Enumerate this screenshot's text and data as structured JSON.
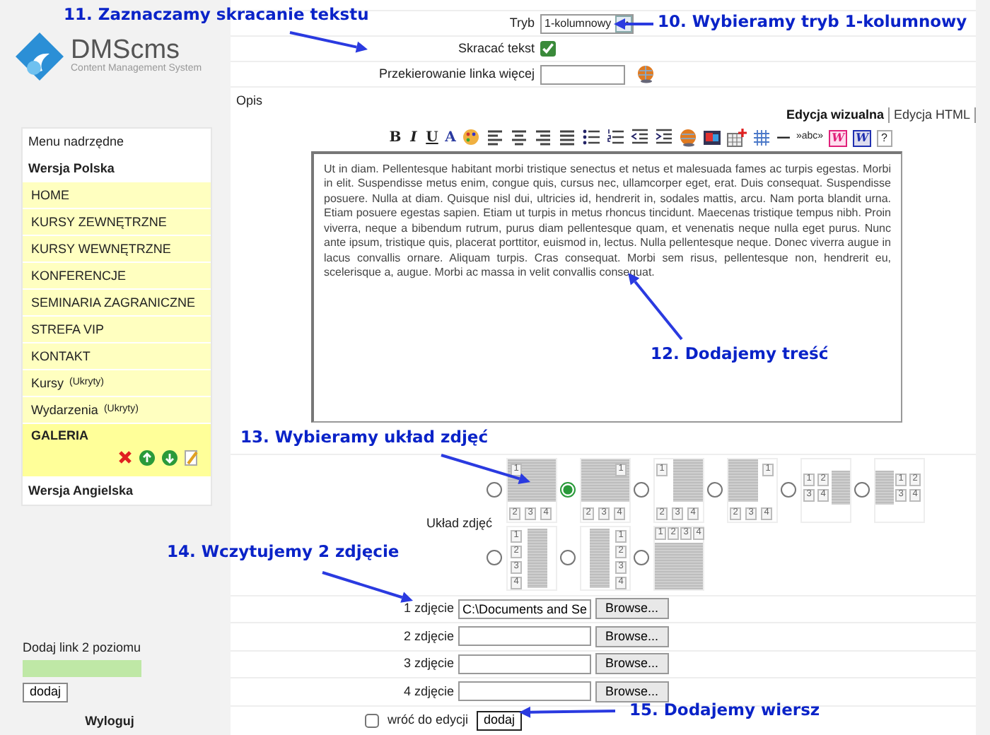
{
  "logo": {
    "name": "DMScms",
    "tagline": "Content Management System"
  },
  "menu": {
    "header": "Menu nadrzędne",
    "groups": [
      {
        "label": "Wersja Polska",
        "items": [
          {
            "label": "HOME",
            "selected": false
          },
          {
            "label": "KURSY ZEWNĘTRZNE",
            "selected": false
          },
          {
            "label": "KURSY WEWNĘTRZNE",
            "selected": false
          },
          {
            "label": "KONFERENCJE",
            "selected": false
          },
          {
            "label": "SEMINARIA ZAGRANICZNE",
            "selected": false
          },
          {
            "label": "STREFA VIP",
            "selected": false
          },
          {
            "label": "KONTAKT",
            "selected": false
          },
          {
            "label": "Kursy",
            "note": "(Ukryty)",
            "selected": false
          },
          {
            "label": "Wydarzenia",
            "note": "(Ukryty)",
            "selected": false
          },
          {
            "label": "GALERIA",
            "selected": true
          }
        ]
      },
      {
        "label": "Wersja Angielska"
      }
    ]
  },
  "add_link": {
    "label": "Dodaj link 2 poziomu",
    "button": "dodaj"
  },
  "logout": "Wyloguj",
  "form": {
    "fields": [
      {
        "kind": "select",
        "label": "Tryb",
        "value": "1-kolumnowy"
      },
      {
        "kind": "checkbox",
        "label": "Skracać tekst",
        "checked": true
      },
      {
        "kind": "link",
        "label": "Przekierowanie linka więcej"
      }
    ]
  },
  "description": {
    "label": "Opis",
    "tabs": [
      {
        "label": "Edycja wizualna",
        "selected": true
      },
      {
        "label": "Edycja HTML",
        "selected": false
      }
    ],
    "toolbar": [
      {
        "kind": "bold",
        "text": "B"
      },
      {
        "kind": "italic",
        "text": "I"
      },
      {
        "kind": "underline",
        "text": "U"
      },
      {
        "kind": "font-color",
        "text": "A"
      },
      {
        "kind": "palette"
      },
      {
        "kind": "align-left"
      },
      {
        "kind": "align-center"
      },
      {
        "kind": "align-right"
      },
      {
        "kind": "align-justify"
      },
      {
        "kind": "list-bullet"
      },
      {
        "kind": "list-number"
      },
      {
        "kind": "outdent"
      },
      {
        "kind": "indent"
      },
      {
        "kind": "link"
      },
      {
        "kind": "image"
      },
      {
        "kind": "table"
      },
      {
        "kind": "grid"
      },
      {
        "kind": "rule",
        "text": "—"
      },
      {
        "kind": "anchor",
        "text": "»abc»"
      },
      {
        "kind": "word-pink",
        "text": "W"
      },
      {
        "kind": "word-blue",
        "text": "W"
      },
      {
        "kind": "help",
        "text": "?"
      }
    ],
    "content": "Ut in diam. Pellentesque habitant morbi tristique senectus et netus et malesuada fames ac turpis egestas. Morbi in elit. Suspendisse metus enim, congue quis, cursus nec, ullamcorper eget, erat. Duis consequat. Suspendisse posuere. Nulla at diam. Quisque nisl dui, ultricies id, hendrerit in, sodales mattis, arcu. Nam porta blandit urna. Etiam posuere egestas sapien. Etiam ut turpis in metus rhoncus tincidunt. Maecenas tristique tempus nibh. Proin viverra, neque a bibendum rutrum, purus diam pellentesque quam, et venenatis neque nulla eget purus. Nunc ante ipsum, tristique quis, placerat porttitor, euismod in, lectus. Nulla pellentesque neque. Donec viverra augue in lacus convallis ornare. Aliquam turpis. Cras consequat. Morbi sem risus, pellentesque non, hendrerit eu, scelerisque a, augue. Morbi ac massa in velit convallis consequat."
  },
  "layout": {
    "label": "Układ zdjęć",
    "options": [
      {
        "kind": "top-1-left",
        "selected": false,
        "numbers": [
          "1",
          "2",
          "3",
          "4"
        ]
      },
      {
        "kind": "top-1-right",
        "selected": true,
        "numbers": [
          "1",
          "2",
          "3",
          "4"
        ]
      },
      {
        "kind": "tall-right",
        "selected": false,
        "numbers": [
          "1",
          "2",
          "3",
          "4"
        ]
      },
      {
        "kind": "tall-left",
        "selected": false,
        "numbers": [
          "1",
          "2",
          "3",
          "4"
        ]
      },
      {
        "kind": "grid-left",
        "selected": false,
        "numbers": [
          "1",
          "2",
          "3",
          "4"
        ]
      },
      {
        "kind": "grid-right",
        "selected": false,
        "numbers": [
          "1",
          "2",
          "3",
          "4"
        ]
      },
      {
        "kind": "column-left",
        "selected": false,
        "numbers": [
          "1",
          "2",
          "3",
          "4"
        ]
      },
      {
        "kind": "column-right",
        "selected": false,
        "numbers": [
          "1",
          "2",
          "3",
          "4"
        ]
      },
      {
        "kind": "row-top",
        "selected": false,
        "numbers": [
          "1",
          "2",
          "3",
          "4"
        ]
      }
    ]
  },
  "photos": [
    {
      "label": "1 zdjęcie",
      "value": "C:\\Documents and Se",
      "button": "Browse..."
    },
    {
      "label": "2 zdjęcie",
      "button": "Browse..."
    },
    {
      "label": "3 zdjęcie",
      "button": "Browse..."
    },
    {
      "label": "4 zdjęcie",
      "button": "Browse..."
    }
  ],
  "footer": {
    "checkbox_label": "wróć do edycji",
    "checked": false,
    "button": "dodaj"
  },
  "annotations": [
    {
      "text": "11. Zaznaczamy skracanie tekstu"
    },
    {
      "text": "10. Wybieramy tryb 1-kolumnowy"
    },
    {
      "text": "12. Dodajemy treść"
    },
    {
      "text": "13. Wybieramy układ zdjęć"
    },
    {
      "text": "14. Wczytujemy 2 zdjęcie"
    },
    {
      "text": "15. Dodajemy wiersz"
    }
  ]
}
